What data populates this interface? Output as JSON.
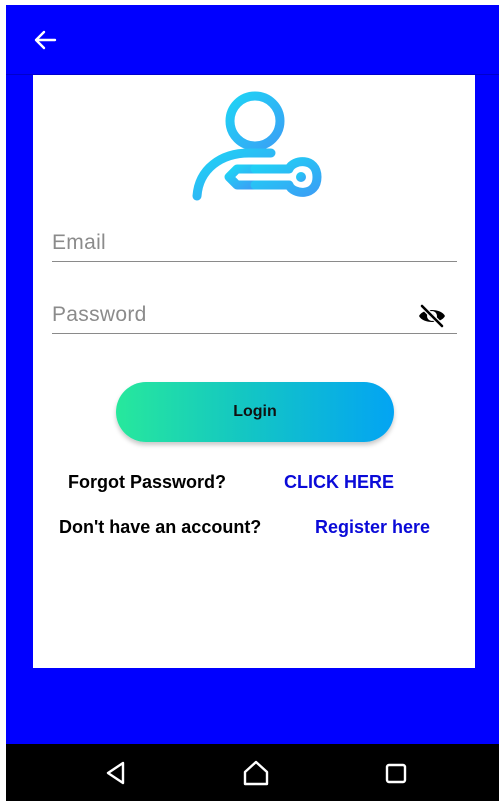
{
  "appbar": {
    "back_icon": "arrow-left-icon"
  },
  "login": {
    "email_placeholder": "Email",
    "password_placeholder": "Password",
    "email_value": "",
    "password_value": "",
    "visibility_icon": "eye-off-icon",
    "login_label": "Login"
  },
  "links": {
    "forgot_label": "Forgot Password?",
    "forgot_link": "CLICK HERE",
    "register_label": "Don't have an account?",
    "register_link": "Register here"
  },
  "icons": {
    "hero": "user-key-icon"
  },
  "colors": {
    "primary": "#0000ff",
    "link": "#0a0ad8",
    "gradient_start": "#27e89c",
    "gradient_end": "#03a4f3",
    "icon_gradient_start": "#1ed4f5",
    "icon_gradient_end": "#3aa0f5"
  },
  "navbar": {
    "back": "nav-back-icon",
    "home": "nav-home-icon",
    "recents": "nav-recents-icon"
  }
}
